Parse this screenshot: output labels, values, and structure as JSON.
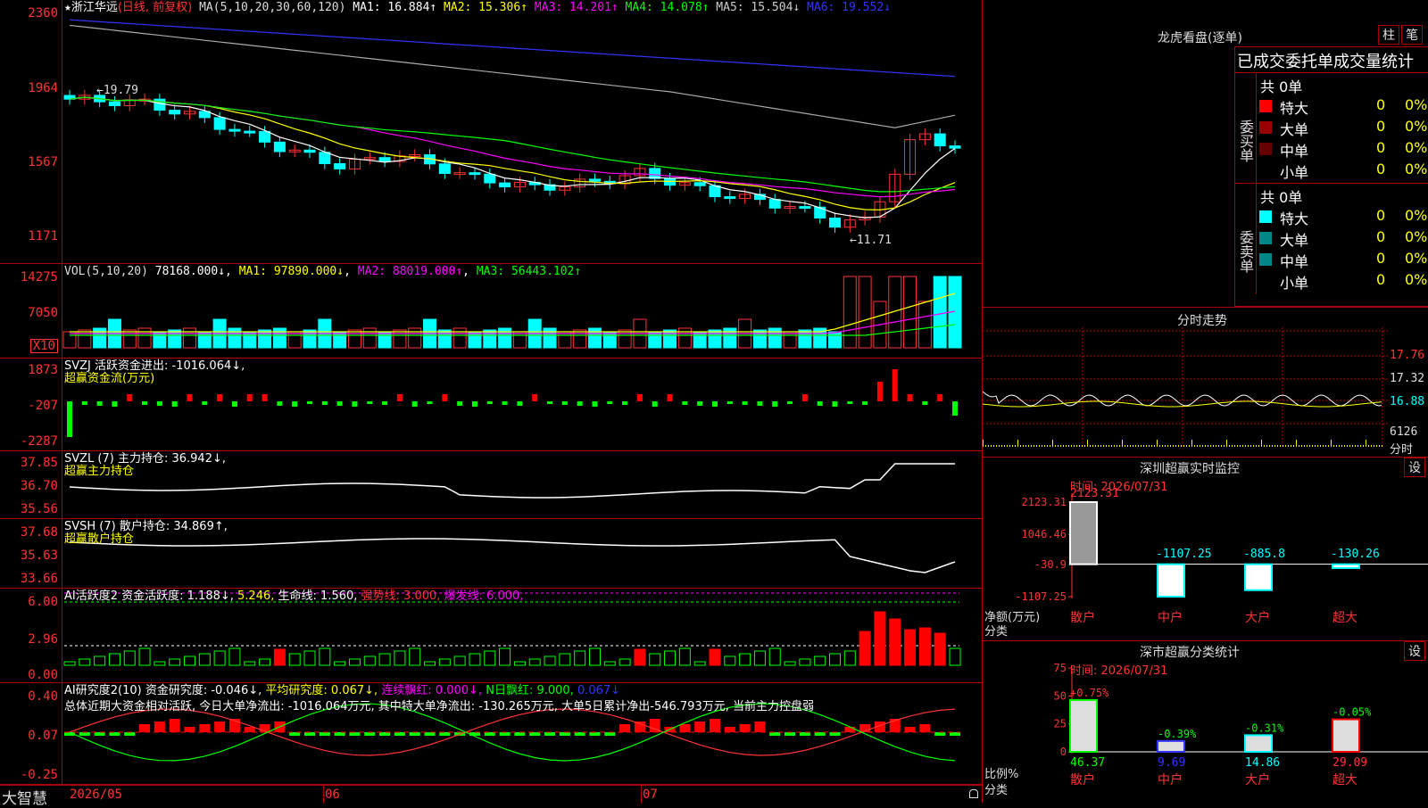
{
  "stock": {
    "marker": "★",
    "name": "浙江华远",
    "mode": "(日线, 前复权)"
  },
  "ma": {
    "label": "MA(5,10,20,30,60,120)",
    "items": [
      {
        "label": "MA1: 16.884↑",
        "color": "#ffffff"
      },
      {
        "label": "MA2: 15.306↑",
        "color": "#ffff00"
      },
      {
        "label": "MA3: 14.201↑",
        "color": "#ff00ff"
      },
      {
        "label": "MA4: 14.078↑",
        "color": "#00ff00"
      },
      {
        "label": "MA5: 15.504↓",
        "color": "#cccccc"
      },
      {
        "label": "MA6: 19.552↓",
        "color": "#3333ff"
      }
    ]
  },
  "price_axis": [
    "2360",
    "1964",
    "1567",
    "1171"
  ],
  "price_marks": {
    "high": "←19.79",
    "low": "←11.71"
  },
  "vol": {
    "label": "VOL(5,10,20)",
    "value": "78168.000↓",
    "ma1": "MA1: 97890.000↓",
    "ma2": "MA2: 88019.000↑",
    "ma3": "MA3: 56443.102↑",
    "axis": [
      "14275",
      "7050"
    ],
    "unit": "X10"
  },
  "svzj": {
    "label": "SVZJ  活跃资金进出: -1016.064↓,",
    "sub": "超赢资金流(万元)",
    "axis": [
      "1873",
      "-207",
      "-2287"
    ]
  },
  "svzl": {
    "label": "SVZL (7) 主力持仓: 36.942↓,",
    "sub": "超赢主力持仓",
    "axis": [
      "37.85",
      "36.70",
      "35.56"
    ]
  },
  "svsh": {
    "label": "SVSH (7) 散户持仓: 34.869↑,",
    "sub": "超赢散户持仓",
    "axis": [
      "37.68",
      "35.63",
      "33.66"
    ]
  },
  "ai_active": {
    "label": "AI活跃度2 资金活跃度: 1.188↓,",
    "v2": "5.246,",
    "life": "生命线: 1.560,",
    "strong": "强势线: 3.000,",
    "burst": "爆发线: 6.000,",
    "axis": [
      "6.00",
      "2.96",
      "0.00"
    ]
  },
  "ai_research": {
    "label": "AI研究度2(10) 资金研究度: -0.046↓,",
    "avg": "平均研究度: 0.067↓,",
    "cont": "连续飘红: 0.000↓,",
    "nday": "N日飘红: 9.000,",
    "last": "0.067↓",
    "summary": "总体近期大资金相对活跃, 今日大单净流出: -1016.064万元, 其中特大单净流出: -130.265万元, 大单5日累计净出-546.793万元, 当前主力控盘弱",
    "axis": [
      "0.40",
      "0.07",
      "-0.25"
    ]
  },
  "footer": {
    "brand": "大智慧",
    "dates": [
      "2026/05",
      "06",
      "07"
    ]
  },
  "dragon": {
    "title": "龙虎看盘(逐单)",
    "btn_zhu": "柱",
    "btn_bi": "笔",
    "header": "已成交委托单成交量统计",
    "buy": {
      "side": "委买单",
      "total": "共 0单",
      "rows": [
        {
          "label": "特大",
          "count": "0",
          "pct": "0%",
          "color": "#ff0000"
        },
        {
          "label": "大单",
          "count": "0",
          "pct": "0%",
          "color": "#990000"
        },
        {
          "label": "中单",
          "count": "0",
          "pct": "0%",
          "color": "#660000"
        },
        {
          "label": "小单",
          "count": "0",
          "pct": "0%",
          "color": "#000000"
        }
      ]
    },
    "sell": {
      "side": "委卖单",
      "total": "共 0单",
      "rows": [
        {
          "label": "特大",
          "count": "0",
          "pct": "0%",
          "color": "#00ffff"
        },
        {
          "label": "大单",
          "count": "0",
          "pct": "0%",
          "color": "#008888"
        },
        {
          "label": "中单",
          "count": "0",
          "pct": "0%",
          "color": "#008888"
        },
        {
          "label": "小单",
          "count": "0",
          "pct": "0%",
          "color": "#000000"
        }
      ]
    }
  },
  "intraday": {
    "title": "分时走势",
    "axis": [
      "17.76",
      "17.32",
      "16.88",
      "6126",
      "分时"
    ]
  },
  "monitor": {
    "title": "深圳超赢实时监控",
    "set": "设",
    "time": "时间: 2026/07/31",
    "axis": [
      "2123.31",
      "1046.46",
      "-30.9",
      "-1107.25"
    ],
    "ylabel": "净额(万元)",
    "xlabel": "分类",
    "chart_data": {
      "type": "bar",
      "categories": [
        "散户",
        "中户",
        "大户",
        "超大"
      ],
      "values": [
        2123.31,
        -1107.25,
        -885.8,
        -130.26
      ],
      "value_labels": [
        "2123.31",
        "-1107.25",
        "-885.8",
        "-130.26"
      ],
      "ylim": [
        -1107.25,
        2123.31
      ]
    }
  },
  "cls": {
    "title": "深市超赢分类统计",
    "set": "设",
    "time": "时间: 2026/07/31",
    "axis": [
      "75",
      "50",
      "25",
      "0"
    ],
    "ylabel": "比例%",
    "xlabel": "分类",
    "chart_data": {
      "type": "bar",
      "categories": [
        "散户",
        "中户",
        "大户",
        "超大"
      ],
      "values": [
        46.37,
        9.69,
        14.86,
        29.09
      ],
      "changes": [
        "+0.75%",
        "-0.39%",
        "-0.31%",
        "-0.05%"
      ],
      "value_labels": [
        "46.37",
        "9.69",
        "14.86",
        "29.09"
      ],
      "ylim": [
        0,
        75
      ]
    }
  }
}
